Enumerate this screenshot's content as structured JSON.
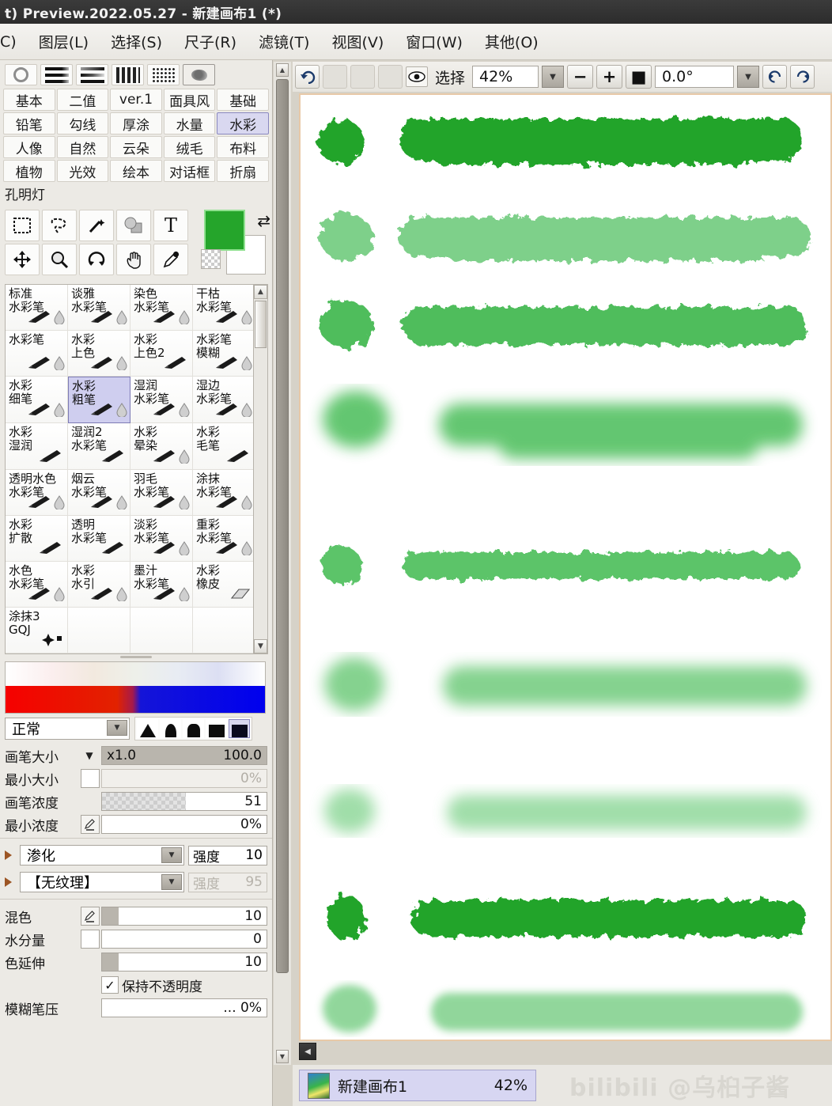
{
  "window": {
    "title": "t) Preview.2022.05.27 - 新建画布1 (*)"
  },
  "menubar": {
    "items": [
      {
        "label": "C)"
      },
      {
        "label": "图层(L)"
      },
      {
        "label": "选择(S)"
      },
      {
        "label": "尺子(R)"
      },
      {
        "label": "滤镜(T)"
      },
      {
        "label": "视图(V)"
      },
      {
        "label": "窗口(W)"
      },
      {
        "label": "其他(O)"
      }
    ]
  },
  "brush_preview": {
    "icons": [
      "circle-outline-icon",
      "solid-bars-icon",
      "fade-bars-icon",
      "dotted-bars-icon",
      "dot-matrix-icon",
      "blob-preview-icon"
    ],
    "selected_index": 5
  },
  "categories": {
    "rows": [
      [
        "基本",
        "二值",
        "ver.1",
        "面具风",
        "基础"
      ],
      [
        "铅笔",
        "勾线",
        "厚涂",
        "水量",
        "水彩"
      ],
      [
        "人像",
        "自然",
        "云朵",
        "绒毛",
        "布料"
      ],
      [
        "植物",
        "光效",
        "绘本",
        "对话框",
        "折扇"
      ],
      [
        "孔明灯"
      ]
    ],
    "active": "水彩"
  },
  "tools": {
    "row1": [
      {
        "name": "marquee-select-tool",
        "icon": "marquee-icon"
      },
      {
        "name": "lasso-select-tool",
        "icon": "lasso-icon"
      },
      {
        "name": "magic-wand-tool",
        "icon": "magic-wand-icon"
      },
      {
        "name": "shape-tool",
        "icon": "shape-icon"
      },
      {
        "name": "text-tool",
        "icon": "text-icon",
        "glyph": "T"
      }
    ],
    "row2": [
      {
        "name": "move-tool",
        "icon": "move-arrows-icon"
      },
      {
        "name": "zoom-tool",
        "icon": "magnifier-icon"
      },
      {
        "name": "rotate-tool",
        "icon": "rotate-icon"
      },
      {
        "name": "hand-tool",
        "icon": "hand-icon"
      },
      {
        "name": "eyedropper-tool",
        "icon": "eyedropper-icon"
      }
    ],
    "foreground_color": "#25a52b",
    "background_color": "#ffffff"
  },
  "brushes": {
    "items": [
      {
        "name": "标准\n水彩笔",
        "icon": "brush-water-icon"
      },
      {
        "name": "谈雅\n水彩笔",
        "icon": "brush-water-icon"
      },
      {
        "name": "染色\n水彩笔",
        "icon": "brush-water-icon"
      },
      {
        "name": "干枯\n水彩笔",
        "icon": "brush-water-icon"
      },
      {
        "name": "水彩笔",
        "icon": "brush-water-icon"
      },
      {
        "name": "水彩\n上色",
        "icon": "brush-water-icon"
      },
      {
        "name": "水彩\n上色2",
        "icon": "brush-icon"
      },
      {
        "name": "水彩笔\n模糊",
        "icon": "brush-water-icon"
      },
      {
        "name": "水彩\n细笔",
        "icon": "brush-water-icon"
      },
      {
        "name": "水彩\n粗笔",
        "icon": "brush-water-icon",
        "selected": true
      },
      {
        "name": "湿润\n水彩笔",
        "icon": "brush-water-icon"
      },
      {
        "name": "湿边\n水彩笔",
        "icon": "brush-water-icon"
      },
      {
        "name": "水彩\n湿润",
        "icon": "brush-icon"
      },
      {
        "name": "湿润2\n水彩笔",
        "icon": "brush-icon"
      },
      {
        "name": "水彩\n晕染",
        "icon": "brush-water-icon"
      },
      {
        "name": "水彩\n毛笔",
        "icon": "brush-icon"
      },
      {
        "name": "透明水色\n水彩笔",
        "icon": "brush-water-icon"
      },
      {
        "name": "烟云\n水彩笔",
        "icon": "brush-water-icon"
      },
      {
        "name": "羽毛\n水彩笔",
        "icon": "brush-water-icon"
      },
      {
        "name": "涂抹\n水彩笔",
        "icon": "brush-water-icon"
      },
      {
        "name": "水彩\n扩散",
        "icon": "brush-icon"
      },
      {
        "name": "透明\n水彩笔",
        "icon": "brush-icon"
      },
      {
        "name": "淡彩\n水彩笔",
        "icon": "brush-water-icon"
      },
      {
        "name": "重彩\n水彩笔",
        "icon": "brush-water-icon"
      },
      {
        "name": "水色\n水彩笔",
        "icon": "brush-water-icon"
      },
      {
        "name": "水彩\n水引",
        "icon": "brush-water-icon"
      },
      {
        "name": "墨汁\n水彩笔",
        "icon": "brush-water-icon"
      },
      {
        "name": "水彩\n橡皮",
        "icon": "eraser-icon"
      },
      {
        "name": "涂抹3\nGQJ",
        "icon": "sparkle-icon"
      }
    ]
  },
  "blend": {
    "mode": "正常",
    "shapes": [
      "cone-sharp-icon",
      "cone-round-icon",
      "cone-flat-icon",
      "square-icon",
      "square-dark-icon"
    ],
    "shape_selected_index": 4
  },
  "params": {
    "rows": [
      {
        "label": "画笔大小",
        "caret": "▼",
        "value_left": "x1.0",
        "value_right": "100.0",
        "fill": 100,
        "style": "solid"
      },
      {
        "label": "最小大小",
        "checkbox": true,
        "value_right": "0%",
        "fill": 0,
        "dim": true
      },
      {
        "label": "画笔浓度",
        "value_right": "51",
        "fill": 51,
        "style": "checker"
      },
      {
        "label": "最小浓度",
        "pen": true,
        "value_right": "0%",
        "fill": 0
      }
    ],
    "effect": {
      "name": "渗化",
      "strength_label": "强度",
      "strength_value": "10"
    },
    "texture": {
      "name": "【无纹理】",
      "strength_label": "强度",
      "strength_value": "95",
      "disabled": true
    },
    "rows2": [
      {
        "label": "混色",
        "pen": true,
        "value_right": "10",
        "fill": 10
      },
      {
        "label": "水分量",
        "checkbox": true,
        "value_right": "0",
        "fill": 0
      },
      {
        "label": "色延伸",
        "value_right": "10",
        "fill": 10
      }
    ],
    "keep_opacity": {
      "label": "保持不透明度",
      "checked": true,
      "mark": "✓"
    },
    "blur_pressure": {
      "label": "模糊笔压",
      "value": "... 0%"
    }
  },
  "canvas_toolbar": {
    "undo_icon": "undo-icon",
    "disabled_buttons": 3,
    "eye_icon": "eye-icon",
    "select_label": "选择",
    "zoom_value": "42%",
    "zoom_out_label": "−",
    "zoom_in_label": "+",
    "zoom_reset_label": "■",
    "rotation_value": "0.0°",
    "rotate_ccw_icon": "rotate-ccw-icon",
    "rotate_cw_icon": "rotate-cw-icon"
  },
  "canvas": {
    "background": "#ffffff",
    "border_color": "#e8c9a8",
    "stroke_color_dark": "#2bac33",
    "stroke_color_light": "#7fd089",
    "cursor": "brush-circle-cursor"
  },
  "statusbar": {
    "document_name": "新建画布1",
    "document_zoom": "42%",
    "watermark": "bilibili @乌桕子酱"
  }
}
